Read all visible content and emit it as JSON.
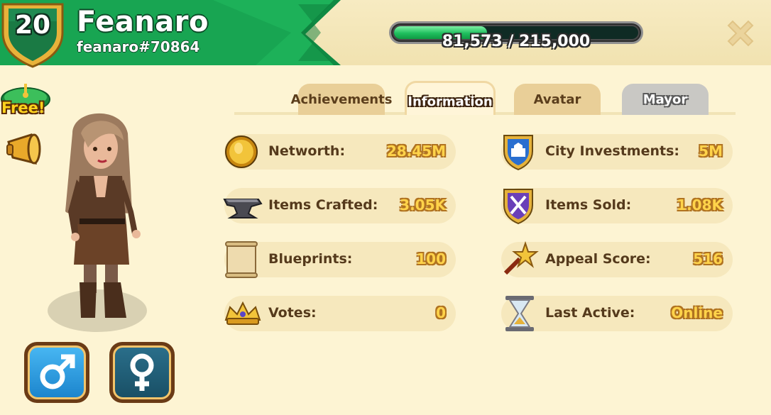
{
  "player": {
    "level": "20",
    "name": "Feanaro",
    "tag": "feanaro#70864"
  },
  "xp": {
    "current": 81573,
    "max": 215000,
    "label": "81,573 / 215,000"
  },
  "left_panel": {
    "free_label": "Free!",
    "gender_options": [
      "male-symbol-icon",
      "female-symbol-icon"
    ]
  },
  "tabs": [
    {
      "label": "Achievements",
      "state": "inactive"
    },
    {
      "label": "Information",
      "state": "active"
    },
    {
      "label": "Avatar",
      "state": "inactive"
    },
    {
      "label": "Mayor",
      "state": "disabled"
    }
  ],
  "stats": {
    "left": [
      {
        "label": "Networth:",
        "value": "28.45M",
        "icon": "gold-coin-icon"
      },
      {
        "label": "Items Crafted:",
        "value": "3.05K",
        "icon": "anvil-icon"
      },
      {
        "label": "Blueprints:",
        "value": "100",
        "icon": "scroll-icon"
      },
      {
        "label": "Votes:",
        "value": "0",
        "icon": "crown-icon"
      }
    ],
    "right": [
      {
        "label": "City Investments:",
        "value": "5M",
        "icon": "city-shield-icon"
      },
      {
        "label": "Items Sold:",
        "value": "1.08K",
        "icon": "crossed-tools-shield-icon"
      },
      {
        "label": "Appeal Score:",
        "value": "516",
        "icon": "star-wand-icon"
      },
      {
        "label": "Last Active:",
        "value": "Online",
        "icon": "hourglass-icon"
      }
    ]
  },
  "colors": {
    "header_green": "#16a050",
    "background": "#fdf4d3",
    "value_gold": "#ffd34a",
    "xp_fill": "#1fbf5e"
  }
}
